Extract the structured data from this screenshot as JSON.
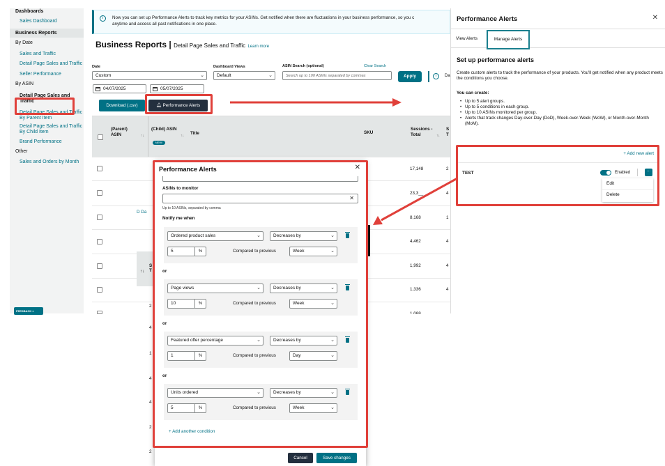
{
  "sidebar": {
    "dashboards_heading": "Dashboards",
    "sales_dashboard": "Sales Dashboard",
    "business_reports_heading": "Business Reports",
    "by_date": "By Date",
    "sales_and_traffic": "Sales and Traffic",
    "detail_page_sales_and_traffic_date": "Detail Page Sales and Traffic",
    "seller_performance": "Seller Performance",
    "by_asin": "By ASIN",
    "detail_page_sales_and_traffic_active": "Detail Page Sales and Traffic",
    "by_parent_item": "Detail Page Sales and Traffic By Parent Item",
    "by_child_item": "Detail Page Sales and Traffic By Child Item",
    "brand_performance": "Brand Performance",
    "other": "Other",
    "sales_orders_by_month": "Sales and Orders by Month",
    "feedback": "FEEDBACK ×"
  },
  "banner": {
    "text": "Now you can set up Performance Alerts to track key metrics for your ASINs. Get notified when there are fluctuations in your business performance, so you c",
    "text2": "anytime and access all past notifications in one place."
  },
  "page": {
    "title": "Business Reports",
    "separator": "|",
    "subtitle": "Detail Page Sales and Traffic",
    "learn_more": "Learn more"
  },
  "filters": {
    "date_label": "Date",
    "date_value": "Custom",
    "views_label": "Dashboard Views",
    "views_value": "Default",
    "asin_label": "ASIN Search (optional)",
    "asin_placeholder": "Search up to 100 ASINs separated by commas",
    "clear_search": "Clear Search",
    "apply": "Apply",
    "info_trailing": "Da",
    "start_date": "04/07/2025",
    "end_date": "05/07/2025",
    "download": "Download (.csv)",
    "performance_alerts": "Performance Alerts"
  },
  "table": {
    "headers": {
      "parent_asin": "(Parent) ASIN",
      "child_asin": "(Child) ASIN",
      "new_badge": "NEW!",
      "title": "Title",
      "sku": "SKU",
      "sessions_total": "Sessions - Total",
      "s_trunc": "S T"
    },
    "sessions": [
      "17,148",
      "23,3__",
      "8,168",
      "4,462",
      "1,992",
      "1,336",
      "1,088"
    ],
    "next_col": [
      "2",
      "4",
      "1",
      "4",
      "4",
      "4",
      "2"
    ],
    "row_fragments": [
      "D Da",
      "S T",
      "2",
      "4",
      "1",
      "4",
      "4",
      "2",
      "2"
    ]
  },
  "right_panel": {
    "title": "Performance Alerts",
    "tab_view": "View Alerts",
    "tab_manage": "Manage Alerts",
    "heading": "Set up performance alerts",
    "description": "Create custom alerts to track the performance of your products. You'll get notified when any product meets the conditions you choose.",
    "you_can_create": "You can create:",
    "bullets": [
      "Up to 5 alert groups.",
      "Up to 5 conditions in each group.",
      "Up to 10 ASINs monitored per group.",
      "Alerts that track changes Day-over-Day (DoD), Week-over-Week (WoW), or Month-over-Month (MoM)."
    ],
    "add_new_alert": "Add new alert",
    "alert_name": "TEST",
    "enabled": "Enabled",
    "more": "···",
    "menu_edit": "Edit",
    "menu_delete": "Delete"
  },
  "modal": {
    "title": "Performance Alerts",
    "asins_label": "ASINs to monitor",
    "asins_hint": "Up to 10 ASINs, separated by comma",
    "notify_label": "Notify me when",
    "compared_to": "Compared to previous",
    "or": "or",
    "conditions": [
      {
        "metric": "Ordered product sales",
        "operator": "Decreases by",
        "value": "5",
        "unit": "%",
        "period": "Week"
      },
      {
        "metric": "Page views",
        "operator": "Decreases by",
        "value": "10",
        "unit": "%",
        "period": "Week"
      },
      {
        "metric": "Featured offer percentage",
        "operator": "Decreases by",
        "value": "1",
        "unit": "%",
        "period": "Day"
      },
      {
        "metric": "Units ordered",
        "operator": "Decreases by",
        "value": "5",
        "unit": "%",
        "period": "Week"
      }
    ],
    "add_condition": "Add another condition",
    "cancel": "Cancel",
    "save": "Save changes"
  },
  "colors": {
    "teal": "#007185",
    "dark": "#232f3e",
    "annotation_red": "#e0403a"
  }
}
